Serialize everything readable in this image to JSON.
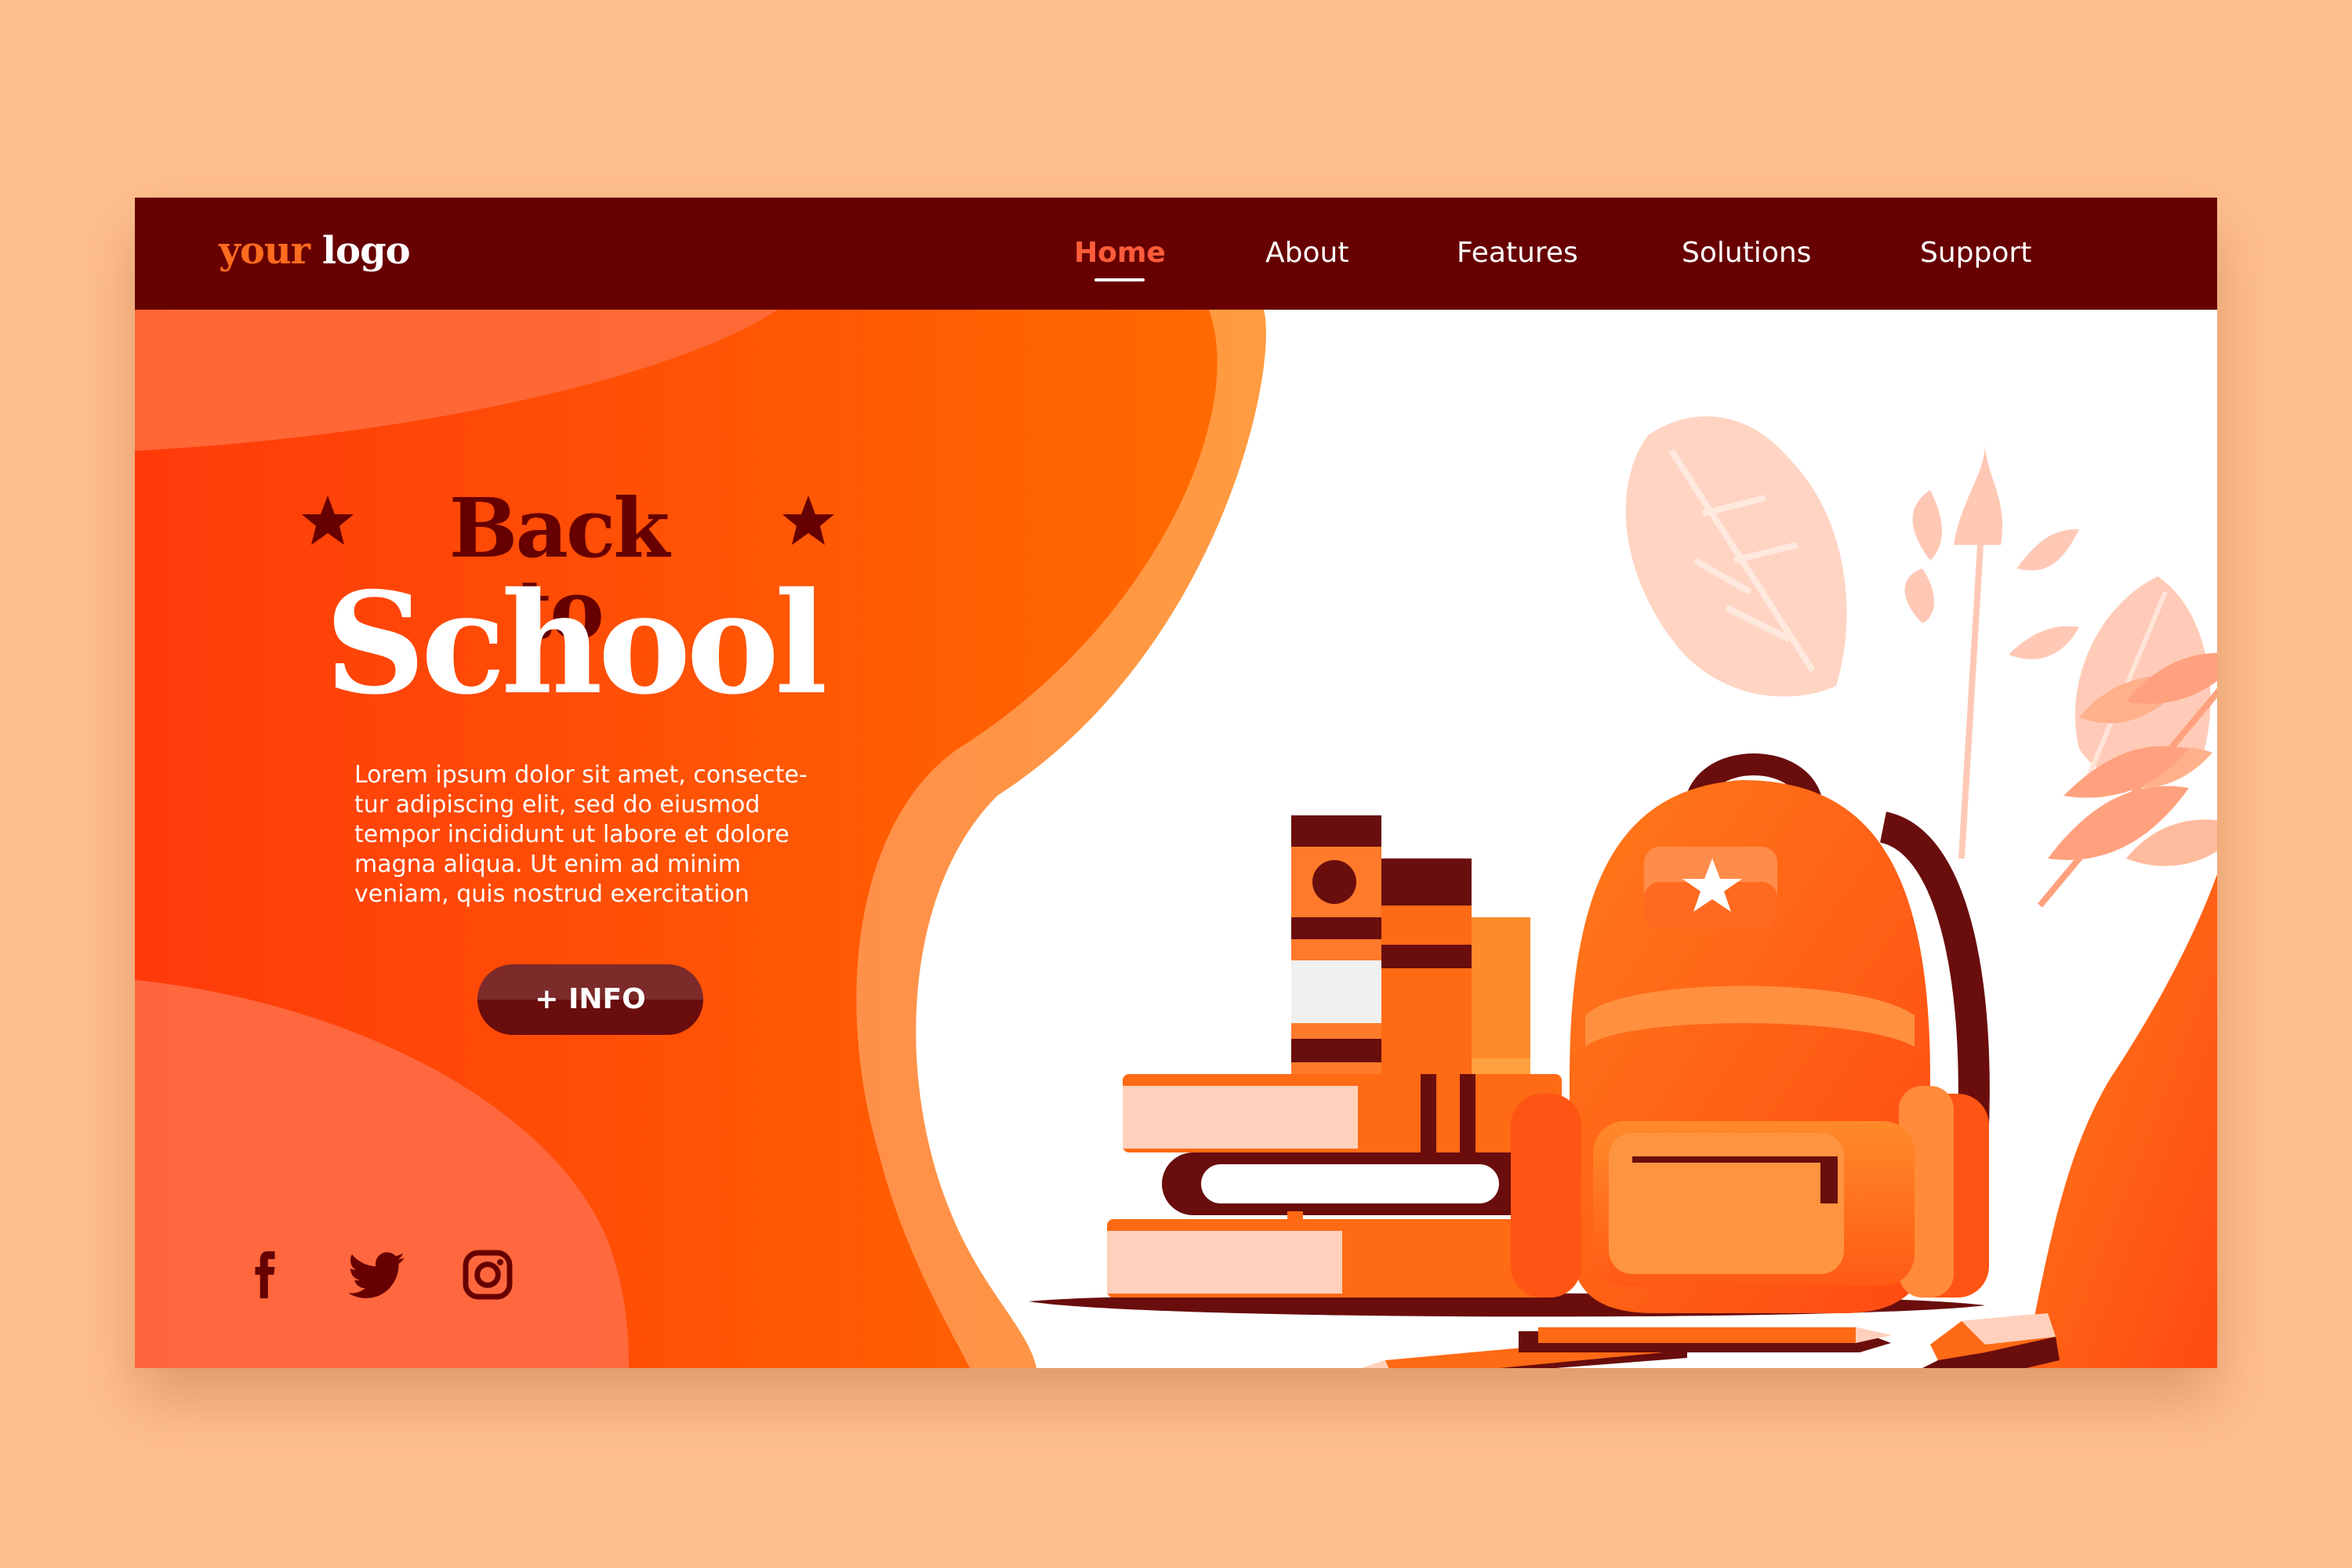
{
  "logo": {
    "part1": "your",
    "part2": "logo"
  },
  "nav": {
    "items": [
      {
        "label": "Home",
        "active": true
      },
      {
        "label": "About"
      },
      {
        "label": "Features"
      },
      {
        "label": "Solutions"
      },
      {
        "label": "Support"
      }
    ]
  },
  "hero": {
    "title_line1": "Back to",
    "title_line2": "School",
    "body_lines": [
      "Lorem ipsum dolor sit amet, consecte-",
      "tur adipiscing elit, sed do eiusmod",
      "tempor incididunt ut labore et dolore",
      "magna aliqua. Ut enim ad minim",
      "veniam, quis nostrud exercitation"
    ],
    "button_label": "+ INFO"
  },
  "social": [
    "facebook-icon",
    "twitter-icon",
    "instagram-icon"
  ],
  "colors": {
    "background": "#ffbf8e",
    "navbar": "#670000",
    "accent": "#ff5c3a",
    "orange": "#ff6a00",
    "dark_red": "#6a0d0d"
  }
}
